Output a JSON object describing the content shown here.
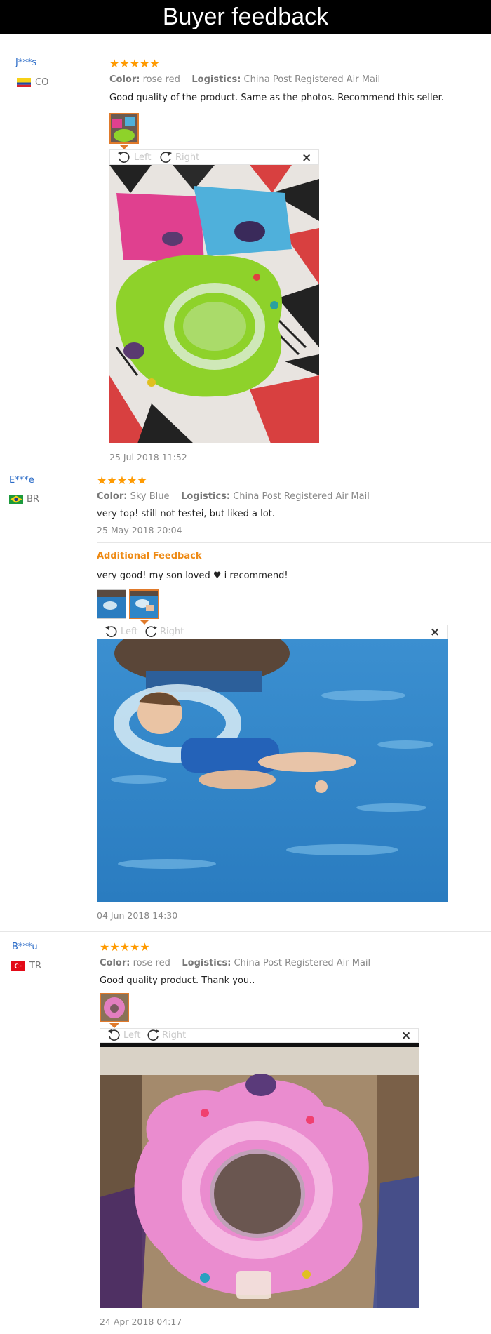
{
  "header": {
    "title": "Buyer feedback"
  },
  "icons": {
    "rotate_left": "rotate-left-icon",
    "rotate_right": "rotate-right-icon",
    "close": "close-icon",
    "star": "star-icon",
    "heart": "heart-icon"
  },
  "colors": {
    "username": "#2a6bc7",
    "stars": "#ff9a00",
    "additional": "#ee8a14",
    "active_thumb": "#e07a2b"
  },
  "toolbar": {
    "left_label": "Left",
    "right_label": "Right",
    "close_label": "×"
  },
  "reviews": [
    {
      "user": "J***s",
      "country": "CO",
      "stars": "★★★★★",
      "rating": 5,
      "color_label": "Color:",
      "color_value": "rose red",
      "logistics_label": "Logistics:",
      "logistics_value": "China Post Registered Air Mail",
      "text": "Good quality of the product. Same as the photos. Recommend this seller.",
      "date": "25 Jul 2018 11:52"
    },
    {
      "user": "E***e",
      "country": "BR",
      "stars": "★★★★★",
      "rating": 5,
      "color_label": "Color:",
      "color_value": "Sky Blue",
      "logistics_label": "Logistics:",
      "logistics_value": "China Post Registered Air Mail",
      "text": "very top! still not testei, but liked a lot.",
      "date": "25 May 2018 20:04",
      "additional_label": "Additional Feedback",
      "additional_text_before": "very good! my son loved",
      "additional_heart": "♥",
      "additional_text_after": "i recommend!",
      "additional_date": "04 Jun 2018 14:30"
    },
    {
      "user": "B***u",
      "country": "TR",
      "stars": "★★★★★",
      "rating": 5,
      "color_label": "Color:",
      "color_value": "rose red",
      "logistics_label": "Logistics:",
      "logistics_value": "China Post Registered Air Mail",
      "text": "Good quality product. Thank you..",
      "date": "24 Apr 2018 04:17"
    }
  ]
}
